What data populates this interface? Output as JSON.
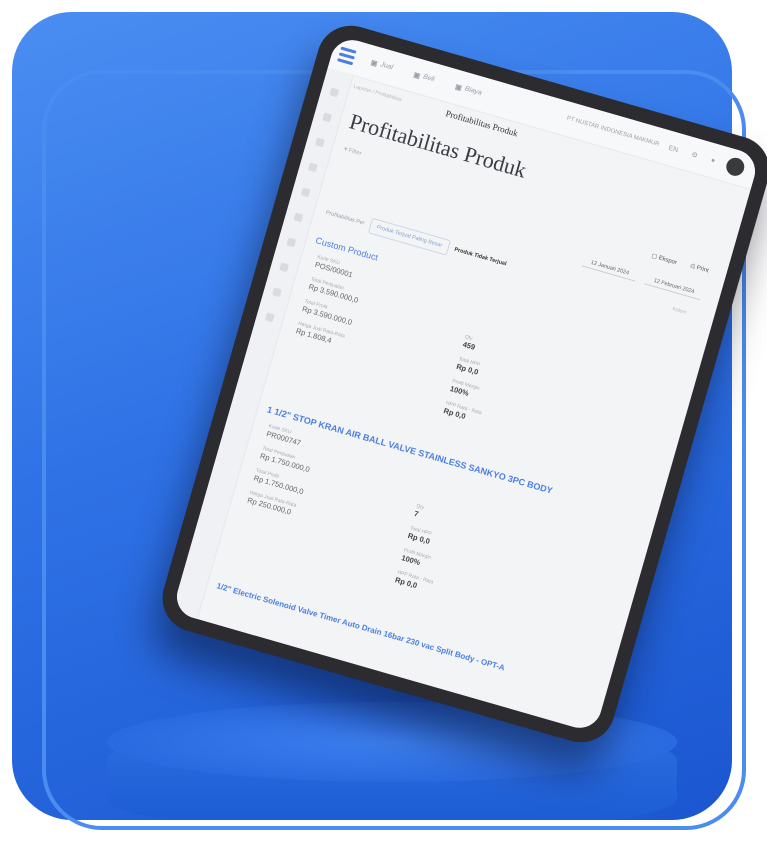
{
  "header": {
    "menu_1": "Jual",
    "menu_2": "Beli",
    "menu_3": "Biaya",
    "company": "PT NUSTAR INDONESIA MAKMUR",
    "lang": "EN"
  },
  "breadcrumbs": "Laporan / Profitabilitas",
  "page": {
    "crumb_title": "Profitabilitas Produk",
    "title": "Profitabilitas Produk",
    "filter_label": "Filter",
    "export_label": "Ekspor",
    "print_label": "Print"
  },
  "tabs": {
    "t1": "Profitabilitas Per",
    "t2": "Produk Terjual Paling Besar",
    "t3": "Produk Tidak Terjual"
  },
  "dates": {
    "from": "12 Januari 2024",
    "to": "12 Februari 2024"
  },
  "columns_btn": "Kolom",
  "products": [
    {
      "name": "Custom Product",
      "code_label": "Kode SKU",
      "code": "POS/00001",
      "sales_label": "Total Penjualan",
      "sales": "Rp 3.590.000,0",
      "profit_label": "Total Profit",
      "profit": "Rp 3.590.000,0",
      "avg_label": "Harga Jual Rata-Rata",
      "avg": "Rp 1.808,4",
      "qty_label": "Qty",
      "qty": "459",
      "hpp_label": "Total HPP",
      "hpp": "Rp 0,0",
      "margin_label": "Profit Margin",
      "margin": "100%",
      "hpp_avg_label": "HPP Rata - Rata",
      "hpp_avg": "Rp 0,0"
    },
    {
      "name": "1 1/2\" STOP KRAN AIR BALL VALVE STAINLESS SANKYO 3PC BODY",
      "code_label": "Kode SKU",
      "code": "PR000747",
      "sales_label": "Total Penjualan",
      "sales": "Rp 1.750.000,0",
      "profit_label": "Total Profit",
      "profit": "Rp 1.750.000,0",
      "avg_label": "Harga Jual Rata-Rata",
      "avg": "Rp 250.000,0",
      "qty_label": "Qty",
      "qty": "7",
      "hpp_label": "Total HPP",
      "hpp": "Rp 0,0",
      "margin_label": "Profit Margin",
      "margin": "100%",
      "hpp_avg_label": "HPP Rata - Rata",
      "hpp_avg": "Rp 0,0"
    },
    {
      "name": "1/2\" Electric Solenoid Valve Timer Auto Drain 16bar 230 vac Split Body - OPT-A"
    }
  ]
}
